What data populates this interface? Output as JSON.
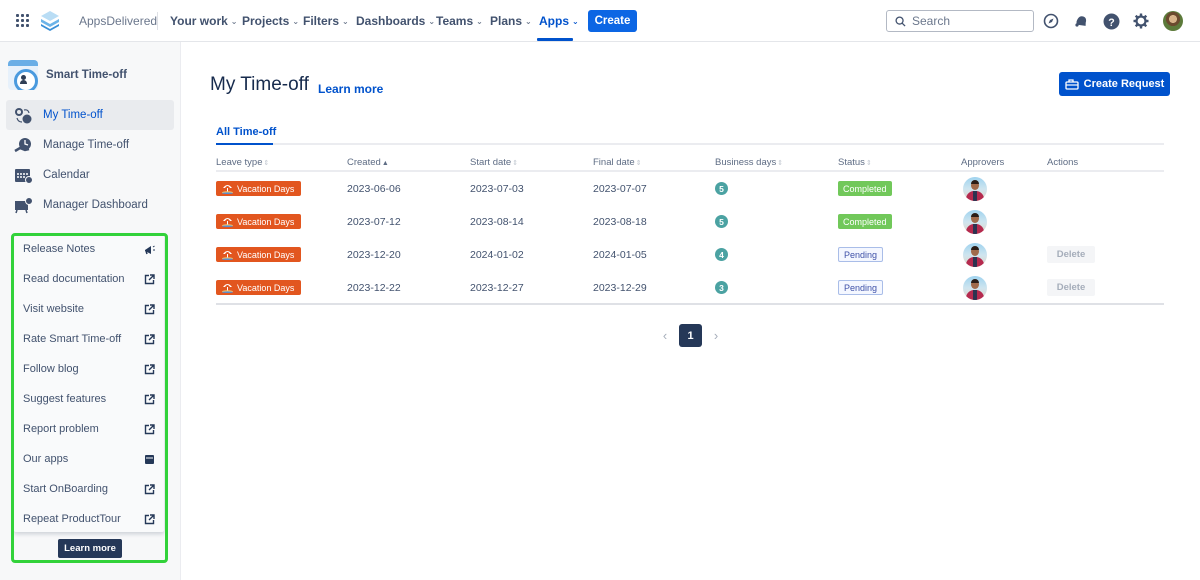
{
  "topnav": {
    "brand": "AppsDelivered",
    "items": [
      {
        "label": "Your work",
        "active": false
      },
      {
        "label": "Projects",
        "active": false
      },
      {
        "label": "Filters",
        "active": false
      },
      {
        "label": "Dashboards",
        "active": false
      },
      {
        "label": "Teams",
        "active": false
      },
      {
        "label": "Plans",
        "active": false
      },
      {
        "label": "Apps",
        "active": true
      }
    ],
    "create_label": "Create",
    "search_placeholder": "Search",
    "icons": [
      "compass-icon",
      "notification-bell-icon",
      "help-icon",
      "settings-gear-icon",
      "user-avatar"
    ]
  },
  "sidebar": {
    "app_title": "Smart Time-off",
    "items": [
      {
        "label": "My Time-off",
        "icon": "my-timeoff-icon",
        "active": true
      },
      {
        "label": "Manage Time-off",
        "icon": "manage-timeoff-icon",
        "active": false
      },
      {
        "label": "Calendar",
        "icon": "calendar-icon",
        "active": false
      },
      {
        "label": "Manager Dashboard",
        "icon": "dashboard-icon",
        "active": false
      }
    ],
    "help_menu": {
      "items": [
        {
          "label": "Release Notes",
          "icon": "megaphone-icon"
        },
        {
          "label": "Read documentation",
          "icon": "external-link-icon"
        },
        {
          "label": "Visit website",
          "icon": "external-link-icon"
        },
        {
          "label": "Rate Smart Time-off",
          "icon": "external-link-icon"
        },
        {
          "label": "Follow blog",
          "icon": "external-link-icon"
        },
        {
          "label": "Suggest features",
          "icon": "external-link-icon"
        },
        {
          "label": "Report problem",
          "icon": "external-link-icon"
        },
        {
          "label": "Our apps",
          "icon": "store-icon"
        },
        {
          "label": "Start OnBoarding",
          "icon": "external-link-icon"
        },
        {
          "label": "Repeat ProductTour",
          "icon": "external-link-icon"
        }
      ],
      "learn_more_label": "Learn more",
      "highlight_color": "#32d23a"
    }
  },
  "main": {
    "title": "My Time-off",
    "learn_more": "Learn more",
    "create_request_label": "Create Request",
    "tabs": [
      {
        "label": "All Time-off",
        "active": true
      }
    ],
    "table": {
      "columns": [
        {
          "label": "Leave type",
          "sortable": true,
          "sorted": false
        },
        {
          "label": "Created",
          "sortable": true,
          "sorted": true
        },
        {
          "label": "Start date",
          "sortable": true,
          "sorted": false
        },
        {
          "label": "Final date",
          "sortable": true,
          "sorted": false
        },
        {
          "label": "Business days",
          "sortable": true,
          "sorted": false
        },
        {
          "label": "Status",
          "sortable": true,
          "sorted": false
        },
        {
          "label": "Approvers",
          "sortable": false,
          "sorted": false
        },
        {
          "label": "Actions",
          "sortable": false,
          "sorted": false
        }
      ],
      "rows": [
        {
          "leave_type": "Vacation Days",
          "created": "2023-06-06",
          "start": "2023-07-03",
          "final": "2023-07-07",
          "days": "5",
          "status": "Completed",
          "status_kind": "completed",
          "action": ""
        },
        {
          "leave_type": "Vacation Days",
          "created": "2023-07-12",
          "start": "2023-08-14",
          "final": "2023-08-18",
          "days": "5",
          "status": "Completed",
          "status_kind": "completed",
          "action": ""
        },
        {
          "leave_type": "Vacation Days",
          "created": "2023-12-20",
          "start": "2024-01-02",
          "final": "2024-01-05",
          "days": "4",
          "status": "Pending",
          "status_kind": "pending",
          "action": "Delete"
        },
        {
          "leave_type": "Vacation Days",
          "created": "2023-12-22",
          "start": "2023-12-27",
          "final": "2023-12-29",
          "days": "3",
          "status": "Pending",
          "status_kind": "pending",
          "action": "Delete"
        }
      ]
    },
    "pagination": {
      "current": "1",
      "prev": "‹",
      "next": "›"
    }
  },
  "colors": {
    "primary": "#0052cc",
    "leave_badge": "#e2561f",
    "completed": "#71c85a",
    "days_badge": "#4ba2a2"
  }
}
